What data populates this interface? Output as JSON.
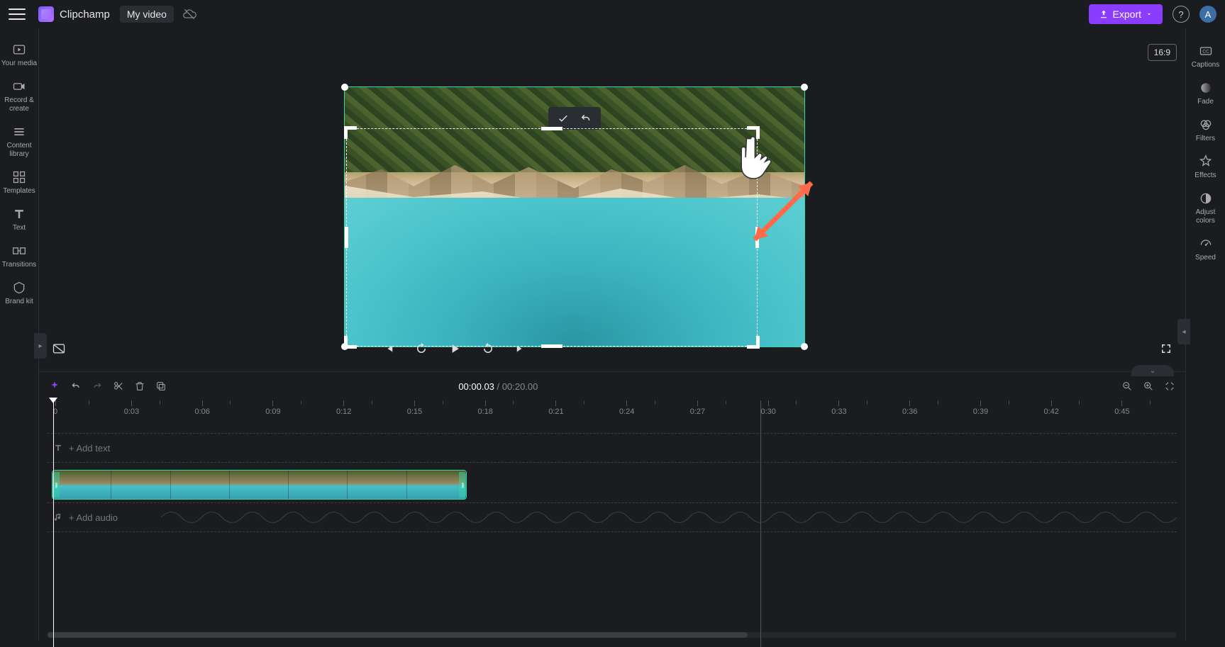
{
  "app": {
    "name": "Clipchamp"
  },
  "project": {
    "title": "My video"
  },
  "export": {
    "label": "Export"
  },
  "avatar": {
    "initial": "A"
  },
  "aspect_badge": "16:9",
  "left_sidebar": {
    "items": [
      {
        "label": "Your media"
      },
      {
        "label": "Record & create"
      },
      {
        "label": "Content library"
      },
      {
        "label": "Templates"
      },
      {
        "label": "Text"
      },
      {
        "label": "Transitions"
      },
      {
        "label": "Brand kit"
      }
    ]
  },
  "right_sidebar": {
    "items": [
      {
        "label": "Captions"
      },
      {
        "label": "Fade"
      },
      {
        "label": "Filters"
      },
      {
        "label": "Effects"
      },
      {
        "label": "Adjust colors"
      },
      {
        "label": "Speed"
      }
    ]
  },
  "playback": {
    "current": "00:00.03",
    "sep": " / ",
    "duration": "00:20.00"
  },
  "ruler": {
    "ticks": [
      "0",
      "0:03",
      "0:06",
      "0:09",
      "0:12",
      "0:15",
      "0:18",
      "0:21",
      "0:24",
      "0:27",
      "0:30",
      "0:33",
      "0:36",
      "0:39",
      "0:42",
      "0:45"
    ]
  },
  "tracks": {
    "text": "+  Add text",
    "audio": "+  Add audio"
  },
  "end_marker_index": 10
}
